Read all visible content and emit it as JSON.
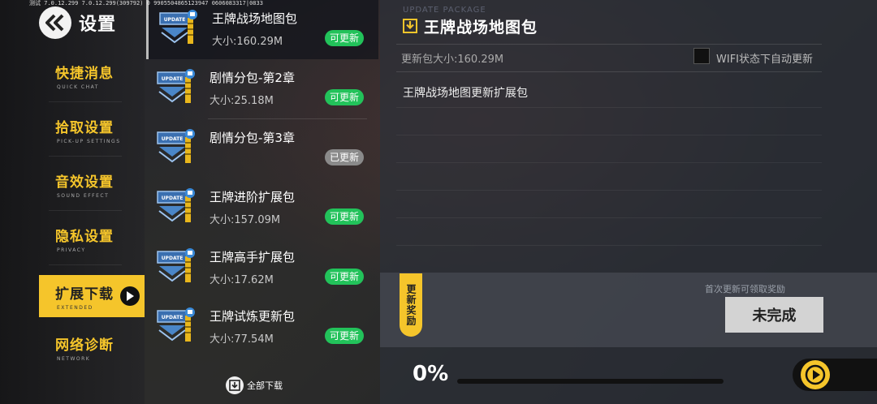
{
  "debug_text": "测试 7.0.12.299 7.0.12.299(309792) 0 9905504865123947 0606083317|0833",
  "header": {
    "title": "设置"
  },
  "nav": {
    "items": [
      {
        "zh": "快捷消息",
        "en": "QUICK CHAT"
      },
      {
        "zh": "拾取设置",
        "en": "PICK-UP SETTINGS"
      },
      {
        "zh": "音效设置",
        "en": "SOUND EFFECT"
      },
      {
        "zh": "隐私设置",
        "en": "PRIVACY"
      },
      {
        "zh": "扩展下载",
        "en": "EXTENDED",
        "active": true
      },
      {
        "zh": "网络诊断",
        "en": "NETWORK"
      }
    ]
  },
  "packages": [
    {
      "name": "王牌战场地图包",
      "size": "大小:160.29M",
      "status": "可更新",
      "selected": true
    },
    {
      "name": "剧情分包-第2章",
      "size": "大小:25.18M",
      "status": "可更新"
    },
    {
      "name": "剧情分包-第3章",
      "size": "",
      "status": "已更新"
    },
    {
      "name": "王牌进阶扩展包",
      "size": "大小:157.09M",
      "status": "可更新"
    },
    {
      "name": "王牌高手扩展包",
      "size": "大小:17.62M",
      "status": "可更新"
    },
    {
      "name": "王牌试炼更新包",
      "size": "大小:77.54M",
      "status": "可更新"
    }
  ],
  "download_all_label": "全部下载",
  "detail": {
    "eyebrow": "UPDATE PACKAGE",
    "title": "王牌战场地图包",
    "size": "更新包大小:160.29M",
    "wifi_label": "WIFI状态下自动更新",
    "wifi_checked": false,
    "description": "王牌战场地图更新扩展包"
  },
  "reward": {
    "tag": "更新奖励",
    "hint": "首次更新可领取奖励",
    "button": "未完成"
  },
  "progress": {
    "label": "0%",
    "value": 0
  },
  "colors": {
    "accent": "#f5c52b",
    "badge_green": "#22c25a",
    "badge_gray": "#8a8a8a"
  },
  "icons": [
    "back-chevron-icon",
    "update-package-icon",
    "download-icon",
    "play-icon",
    "chevron-right-icon"
  ]
}
